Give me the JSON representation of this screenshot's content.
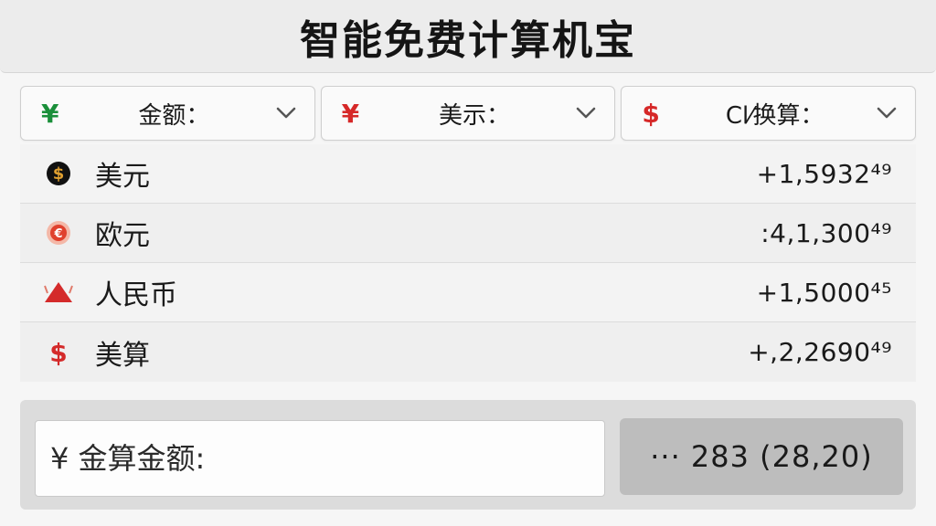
{
  "app": {
    "title": "智能免费计算机宝"
  },
  "selectors": [
    {
      "symbol": "¥",
      "label": "金额：",
      "icon": "chevron-down-icon",
      "color": "#1a8f3a"
    },
    {
      "symbol": "¥",
      "label": "美示：",
      "icon": "chevron-down-icon",
      "color": "#d62828"
    },
    {
      "symbol": "$",
      "label": "Cl⁄换算：",
      "icon": "chevron-down-icon",
      "color": "#d62828"
    }
  ],
  "rates": [
    {
      "icon": "dollar-coin-icon",
      "name": "美元",
      "value": "+1,5932⁴⁹"
    },
    {
      "icon": "euro-coin-icon",
      "name": "欧元",
      "value": ":4,1,300⁴⁹"
    },
    {
      "icon": "triangle-icon",
      "name": "人民币",
      "value": "+1,5000⁴⁵"
    },
    {
      "icon": "dollar-sign-icon",
      "name": "美算",
      "value": "+,2,2690⁴⁹"
    }
  ],
  "input": {
    "placeholder": "¥ 金算金额:"
  },
  "result": {
    "text": "··· 283 (28,20)"
  },
  "colors": {
    "accent_green": "#1a8f3a",
    "accent_red": "#d62828"
  }
}
